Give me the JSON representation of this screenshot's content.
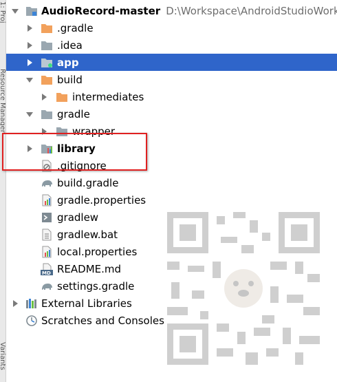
{
  "side_tabs": {
    "project": "1: Proj",
    "resource_manager": "Resource Manager",
    "build_variants": "Variants"
  },
  "tree": {
    "root": {
      "name": "AudioRecord-master",
      "path": "D:\\Workspace\\AndroidStudioWorksp"
    },
    "gradle_dir": ".gradle",
    "idea_dir": ".idea",
    "app": "app",
    "build": "build",
    "intermediates": "intermediates",
    "gradle": "gradle",
    "wrapper": "wrapper",
    "library": "library",
    "gitignore": ".gitignore",
    "build_gradle": "build.gradle",
    "gradle_properties": "gradle.properties",
    "gradlew": "gradlew",
    "gradlew_bat": "gradlew.bat",
    "local_properties": "local.properties",
    "readme": "README.md",
    "settings_gradle": "settings.gradle",
    "external_libraries": "External Libraries",
    "scratches": "Scratches and Consoles"
  },
  "colors": {
    "selection": "#2f65ca",
    "folder_orange": "#f2a15c",
    "folder_gray": "#9aa7b0",
    "annotation": "#e02020"
  },
  "icons": {
    "expanded": "chevron-down-icon",
    "collapsed": "chevron-right-icon",
    "folder": "folder-icon",
    "module": "module-folder-icon",
    "gradle_file": "gradle-elephant-icon",
    "properties_file": "properties-file-icon",
    "script_file": "shell-script-icon",
    "text_file": "text-file-icon",
    "markdown_file": "markdown-file-icon",
    "ignore_file": "ignore-file-icon",
    "libraries": "libraries-icon",
    "scratches": "scratches-icon"
  }
}
